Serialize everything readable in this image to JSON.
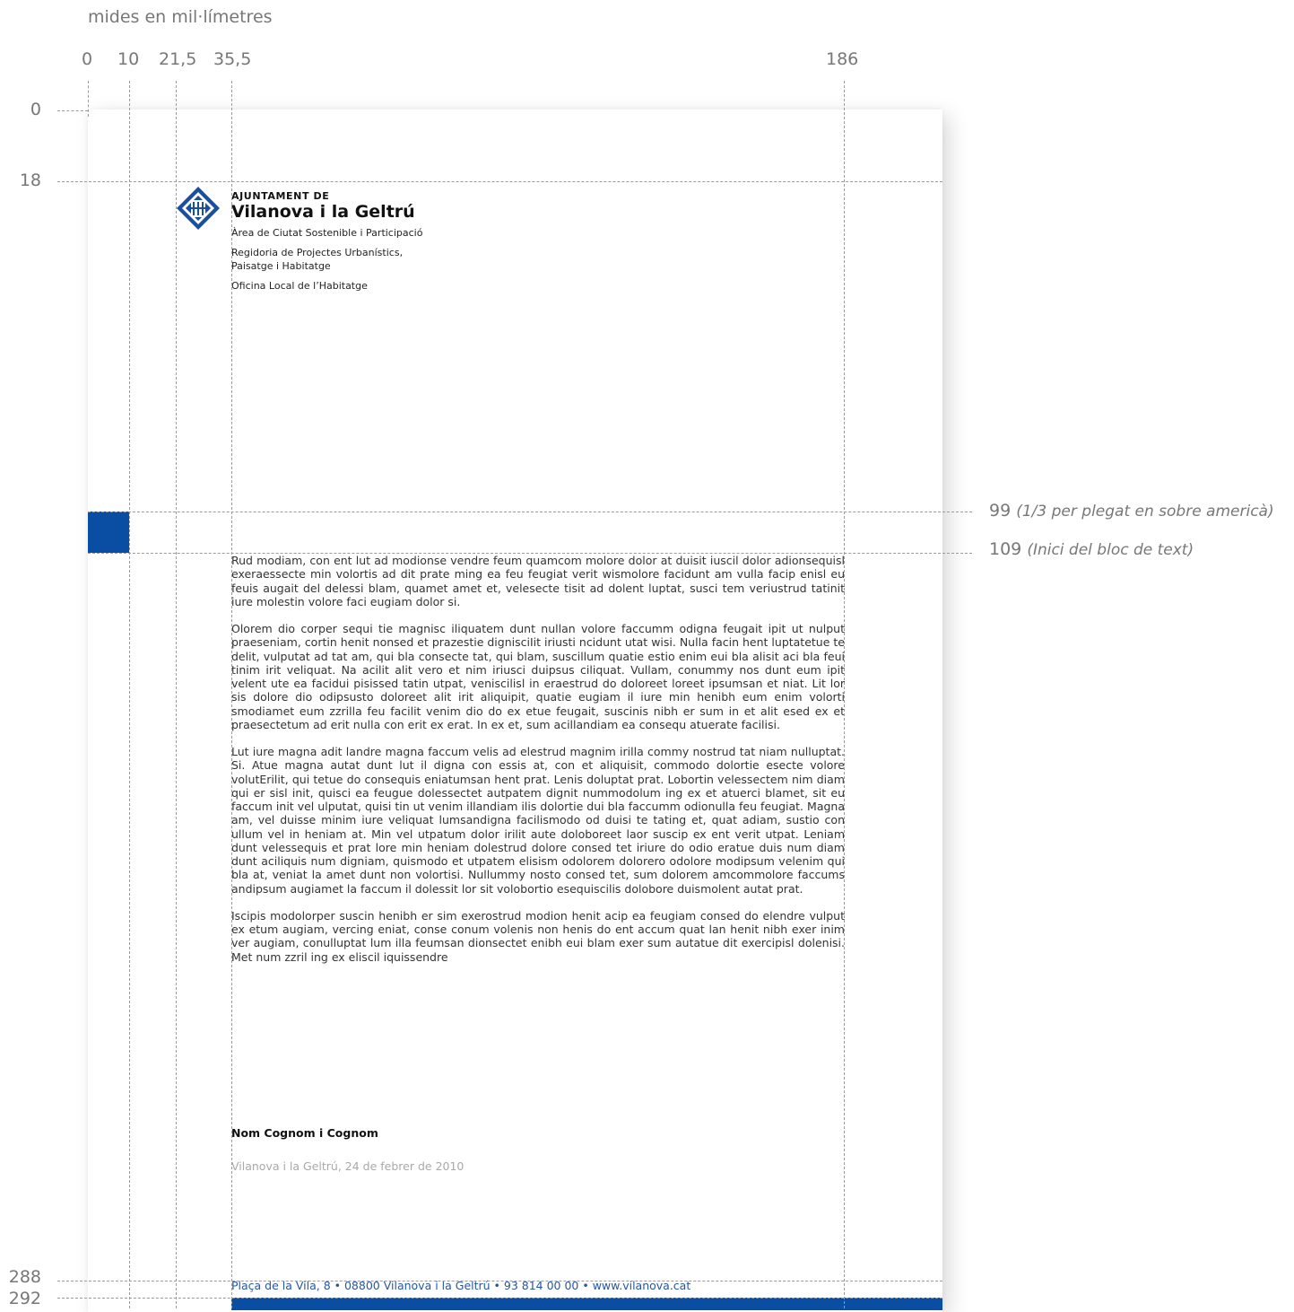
{
  "units_caption": "mides en mil·límetres",
  "x_marks": [
    "0",
    "10",
    "21,5",
    "35,5",
    "186"
  ],
  "y_marks": [
    "0",
    "18",
    "288",
    "292"
  ],
  "annotations": [
    {
      "value": "99",
      "note": "(1/3 per plegat en sobre americà)"
    },
    {
      "value": "109",
      "note": "(Inici del bloc de text)"
    }
  ],
  "letterhead": {
    "org_prefix": "AJUNTAMENT DE",
    "org_name": "Vilanova i la Geltrú",
    "dept_lines": [
      "Àrea de Ciutat Sostenible i Participació",
      "Regidoria de Projectes Urbanístics,",
      "Paisatge i Habitatge",
      "Oficina Local de l’Habitatge"
    ]
  },
  "body_paragraphs": [
    "Rud modiam, con ent lut ad modionse vendre feum quamcom molore dolor at duisit iuscil dolor adionsequisl exeraessecte min volortis ad dit prate ming ea feu feugiat verit wismolore facidunt am vulla facip enisl eu feuis augait del delessi blam, quamet amet et, velesecte tisit ad dolent luptat, susci tem veriustrud tatinit iure molestin volore faci eugiam dolor si.",
    "Olorem dio corper sequi tie magnisc iliquatem dunt nullan volore faccumm odigna feugait ipit ut nulput praeseniam, cortin henit nonsed et prazestie dignisciIit iriusti ncidunt utat wisi. Nulla facin hent luptatetue te delit, vulputat ad tat am, qui bla consecte tat, qui blam, suscillum quatie estio enim eui bla alisit aci bla feui tinim irit veliquat. Na acilit alit vero et nim iriusci duipsus ciliquat. Vullam, conummy nos dunt eum ipit velent ute ea facidui pisissed tatin utpat, veniscilisl in eraestrud do doloreet loreet ipsumsan et niat. Lit lor sis dolore dio odipsusto doloreet alit irit aliquipit, quatie eugiam il iure min henibh eum enim volorti smodiamet eum zzrilla feu facilit venim dio do ex etue feugait, suscinis nibh er sum in et alit esed ex et praesectetum ad erit nulla con erit ex erat. In ex et, sum acillandiam ea consequ atuerate facilisi.",
    "Lut iure magna adit landre magna faccum velis ad elestrud magnim irilla commy nostrud tat niam nulluptat. Si. Atue magna autat dunt lut il digna con essis at, con et aliquisit, commodo dolortie esecte volore volutErilit, qui tetue do consequis eniatumsan hent prat. Lenis doluptat prat. Lobortin velessectem nim diam qui er sisl init, quisci ea feugue dolessectet autpatem dignit nummodolum ing ex et atuerci blamet, sit eu faccum init vel ulputat, quisi tin ut venim illandiam ilis dolortie dui bla faccumm odionulla feu feugiat. Magna am, vel duisse minim iure veliquat lumsandigna facilismodo od duisi te tating et, quat adiam, sustio con ullum vel in heniam at. Min vel utpatum dolor irilit aute doloboreet laor suscip ex ent verit utpat. Leniam dunt velessequis et prat lore min heniam dolestrud dolore consed tet iriure do odio eratue duis num diam dunt aciliquis num digniam, quismodo et utpatem elisism odolorem dolorero odolore modipsum velenim qui bla at, veniat la amet dunt non volortisi. Nullummy nosto consed tet, sum dolorem amcommolore faccums andipsum augiamet la faccum il dolessit lor sit volobortio esequiscilis dolobore duismolent autat prat.",
    "Iscipis modolorper suscin henibh er sim exerostrud modion henit acip ea feugiam consed do elendre vulput ex etum augiam, vercing eniat, conse conum volenis non henis do ent accum quat lan henit nibh exer inim ver augiam, conulluptat lum illa feumsan dionsectet enibh eui blam exer sum autatue dit exercipisl dolenisi. Met num zzril ing ex eliscil iquissendre"
  ],
  "signature": {
    "name": "Nom Cognom i Cognom",
    "place_date": "Vilanova i la Geltrú, 24 de febrer de 2010"
  },
  "footer": "Plaça de la Vila, 8 • 08800 Vilanova i la Geltrú • 93 814 00 00 • www.vilanova.cat",
  "colors": {
    "accent_blue": "#0a4ea3",
    "footer_text": "#2457a6",
    "guide": "#9a9a9a",
    "label": "#777777"
  }
}
